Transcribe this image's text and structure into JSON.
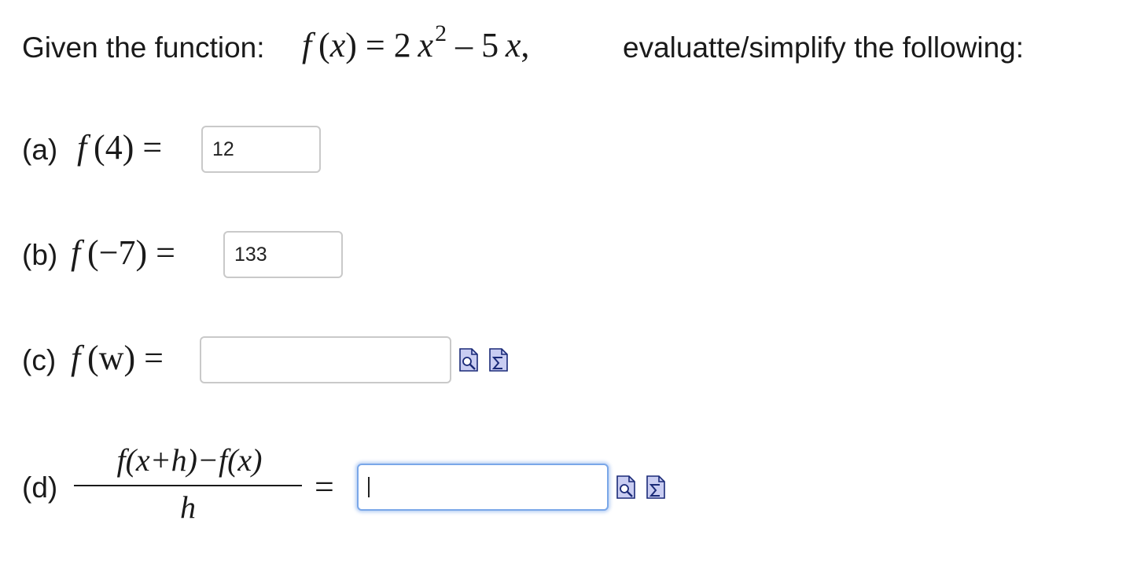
{
  "intro": {
    "lead": "Given the function:",
    "trail": "evaluatte/simplify the following:",
    "math": {
      "f": "f",
      "lparen": "(",
      "x": "x",
      "rparen": ")",
      "eq": "=",
      "coef": "2",
      "x2": "x",
      "exp": "2",
      "minus": "–",
      "coef2": "5",
      "x3": "x",
      "comma": ","
    }
  },
  "parts": {
    "a": {
      "label": "(a)",
      "f": "f",
      "arg": "(4)",
      "eq": "=",
      "value": "12"
    },
    "b": {
      "label": "(b)",
      "f": "f",
      "arg": "(−7)",
      "eq": "=",
      "value": "133"
    },
    "c": {
      "label": "(c)",
      "f": "f",
      "arg": "(w)",
      "eq": "=",
      "value": ""
    },
    "d": {
      "label": "(d)",
      "numerator": "f(x+h)−f(x)",
      "denominator": "h",
      "eq": "=",
      "value": ""
    }
  },
  "icons": {
    "preview": "preview-icon",
    "equation_editor": "sigma-icon"
  },
  "colors": {
    "icon_fill": "#c9cdf2",
    "icon_stroke": "#1a2a78",
    "focus_border": "#7aa7e8"
  }
}
